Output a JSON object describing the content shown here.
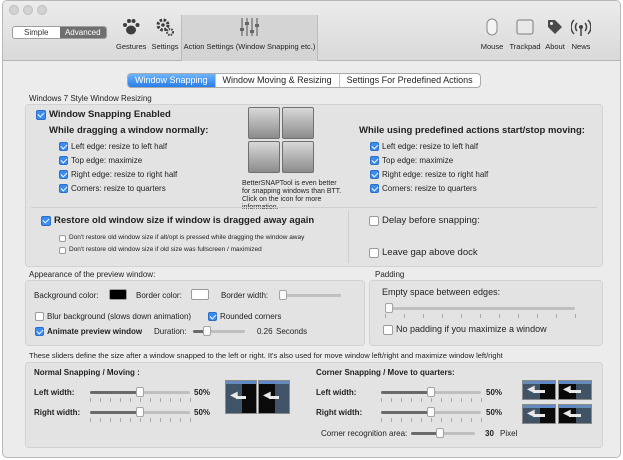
{
  "toolbar": {
    "mode_simple": "Simple",
    "mode_advanced": "Advanced",
    "gestures": "Gestures",
    "settings": "Settings",
    "action_settings": "Action Settings (Window Snapping etc.)",
    "mouse": "Mouse",
    "trackpad": "Trackpad",
    "about": "About",
    "news": "News"
  },
  "tabs": [
    "Window Snapping",
    "Window Moving & Resizing",
    "Settings For Predefined Actions"
  ],
  "win7": {
    "group_title": "Windows 7 Style Window Resizing",
    "snapping_enabled": "Window Snapping Enabled",
    "dragging_title": "While dragging a window normally:",
    "dragging_options": [
      "Left edge: resize to left half",
      "Top edge: maximize",
      "Right edge: resize to right half",
      "Corners: resize to quarters"
    ],
    "predefined_title": "While using predefined actions start/stop moving:",
    "predefined_options": [
      "Left edge: resize to left half",
      "Top edge: maximize",
      "Right edge: resize to right half",
      "Corners: resize to quarters"
    ],
    "promo_text": [
      "BetterSNAPTool is even better",
      "for snapping windows than BTT.",
      "Click on the icon for more",
      "information."
    ],
    "restore_label": "Restore old window size if window is dragged away again",
    "restore_sub1": "Don't restore old window size if alt/opt is pressed while dragging the window away",
    "restore_sub2": "Don't restore old window size if old size was fullscreen / maximized",
    "delay_label": "Delay before snapping:",
    "gap_label": "Leave gap above dock"
  },
  "preview": {
    "title": "Appearance of the preview window:",
    "bg_color_label": "Background color:",
    "border_color_label": "Border color:",
    "border_width_label": "Border width:",
    "blur_label": "Blur background (slows down animation)",
    "rounded_label": "Rounded corners",
    "animate_label": "Animate preview window",
    "duration_label": "Duration:",
    "duration_value": "0.26",
    "duration_unit": "Seconds",
    "bg_color": "#000000",
    "border_color": "#ffffff"
  },
  "padding": {
    "title": "Padding",
    "empty_space_label": "Empty space between edges:",
    "no_padding_label": "No padding if you maximize a window"
  },
  "sliders_info": "These sliders define the size after a window snapped to the left or right. It's also used for move window left/right and maximize window left/right",
  "normal": {
    "title": "Normal Snapping / Moving :",
    "left_label": "Left width:",
    "left_value": "50%",
    "right_label": "Right width:",
    "right_value": "50%"
  },
  "corner": {
    "title": "Corner Snapping / Move to quarters:",
    "left_label": "Left width:",
    "left_value": "50%",
    "right_label": "Right width:",
    "right_value": "50%",
    "recognition_label": "Corner recognition area:",
    "recognition_value": "30",
    "recognition_unit": "Pixel"
  },
  "colors": {
    "accent": "#3b8ced",
    "tab_active": "#2b7de9"
  },
  "icons": [
    "paw-icon",
    "gear-icon",
    "sliders-icon",
    "mouse-icon",
    "trackpad-icon",
    "tag-icon",
    "wifi-icon"
  ]
}
